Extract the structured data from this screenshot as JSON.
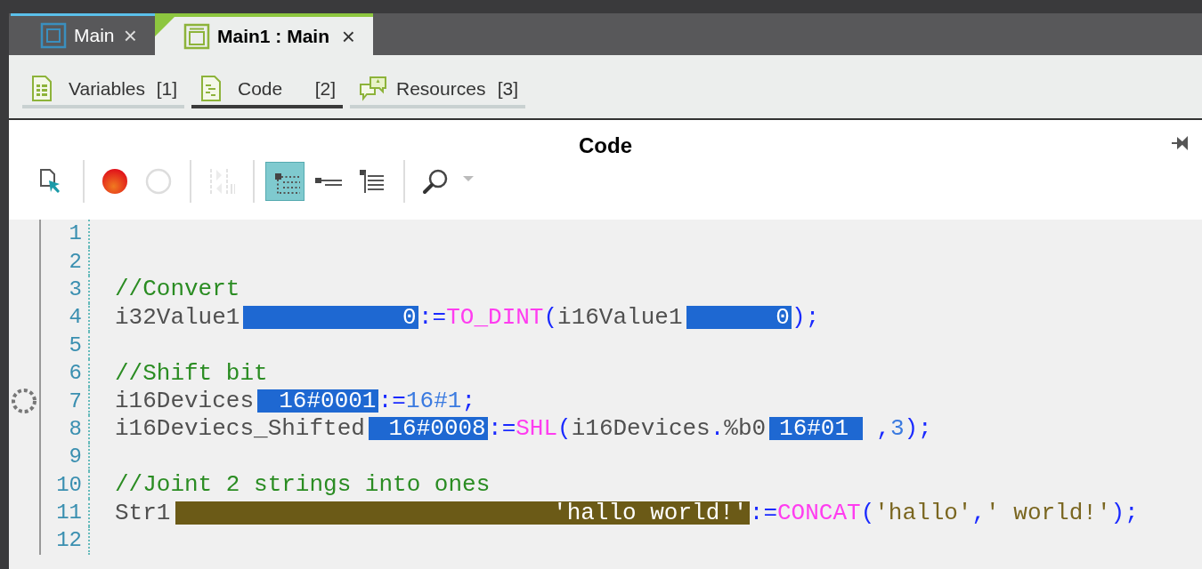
{
  "tabs": [
    {
      "label": "Main",
      "close": "×",
      "selected": false
    },
    {
      "label": "Main1 : Main",
      "close": "×",
      "selected": true
    }
  ],
  "views": [
    {
      "kind": "variables",
      "label": "Variables",
      "count": "[1]",
      "selected": false
    },
    {
      "kind": "code",
      "label": "Code",
      "count": "[2]",
      "selected": true
    },
    {
      "kind": "resources",
      "label": "Resources",
      "count": "[3]",
      "selected": false
    }
  ],
  "panel": {
    "title": "Code"
  },
  "toolbar": [
    {
      "kind": "pointer",
      "disabled": false
    },
    {
      "kind": "separator"
    },
    {
      "kind": "breakpoint-set",
      "disabled": false
    },
    {
      "kind": "breakpoint-clear",
      "disabled": false
    },
    {
      "kind": "separator"
    },
    {
      "kind": "columns",
      "disabled": true
    },
    {
      "kind": "separator"
    },
    {
      "kind": "tree",
      "disabled": false,
      "selected": true
    },
    {
      "kind": "collapse",
      "disabled": false,
      "selected": false
    },
    {
      "kind": "expand",
      "disabled": false,
      "selected": false
    },
    {
      "kind": "separator"
    },
    {
      "kind": "search",
      "disabled": false
    },
    {
      "kind": "overflow",
      "disabled": false
    }
  ],
  "lines": [
    {
      "number": "1",
      "breakpoint": false
    },
    {
      "number": "2",
      "breakpoint": false
    },
    {
      "number": "3",
      "breakpoint": false,
      "tokens": [
        {
          "kind": "comment",
          "text": "//Convert"
        }
      ]
    },
    {
      "number": "4",
      "breakpoint": false,
      "tokens": [
        {
          "kind": "ident",
          "text": "i32Value1"
        },
        {
          "kind": "value",
          "text": "0"
        },
        {
          "kind": "op",
          "text": ":="
        },
        {
          "kind": "func",
          "text": "TO_DINT"
        },
        {
          "kind": "op",
          "text": "("
        },
        {
          "kind": "ident",
          "text": "i16Value1"
        },
        {
          "kind": "value",
          "text": "0"
        },
        {
          "kind": "op",
          "text": ");"
        }
      ]
    },
    {
      "number": "5",
      "breakpoint": false
    },
    {
      "number": "6",
      "breakpoint": false,
      "tokens": [
        {
          "kind": "comment",
          "text": "//Shift bit"
        }
      ]
    },
    {
      "number": "7",
      "breakpoint": true,
      "tokens": [
        {
          "kind": "ident",
          "text": "i16Devices"
        },
        {
          "kind": "value",
          "text": "16#0001"
        },
        {
          "kind": "op",
          "text": ":="
        },
        {
          "kind": "num",
          "text": "16#1"
        },
        {
          "kind": "op",
          "text": ";"
        }
      ]
    },
    {
      "number": "8",
      "breakpoint": false,
      "tokens": [
        {
          "kind": "ident",
          "text": "i16Deviecs_Shifted"
        },
        {
          "kind": "value",
          "text": "16#0008"
        },
        {
          "kind": "op",
          "text": ":="
        },
        {
          "kind": "func",
          "text": "SHL"
        },
        {
          "kind": "op",
          "text": "("
        },
        {
          "kind": "ident",
          "text": "i16Devices"
        },
        {
          "kind": "op",
          "text": "."
        },
        {
          "kind": "ident",
          "text": "%b0"
        },
        {
          "kind": "value",
          "text": "16#01"
        },
        {
          "kind": "op",
          "text": " ,"
        },
        {
          "kind": "num",
          "text": "3"
        },
        {
          "kind": "op",
          "text": ");"
        }
      ]
    },
    {
      "number": "9",
      "breakpoint": false
    },
    {
      "number": "10",
      "breakpoint": false,
      "tokens": [
        {
          "kind": "comment",
          "text": "//Joint 2 strings into ones"
        }
      ]
    },
    {
      "number": "11",
      "breakpoint": false,
      "tokens": [
        {
          "kind": "ident",
          "text": "Str1"
        },
        {
          "kind": "strvalue",
          "text": "'hallo world!'"
        },
        {
          "kind": "op",
          "text": ":="
        },
        {
          "kind": "func",
          "text": "CONCAT"
        },
        {
          "kind": "op",
          "text": "("
        },
        {
          "kind": "str",
          "text": "'hallo'"
        },
        {
          "kind": "op",
          "text": ","
        },
        {
          "kind": "str",
          "text": "' world!'"
        },
        {
          "kind": "op",
          "text": ");"
        }
      ]
    },
    {
      "number": "12",
      "breakpoint": false
    }
  ]
}
